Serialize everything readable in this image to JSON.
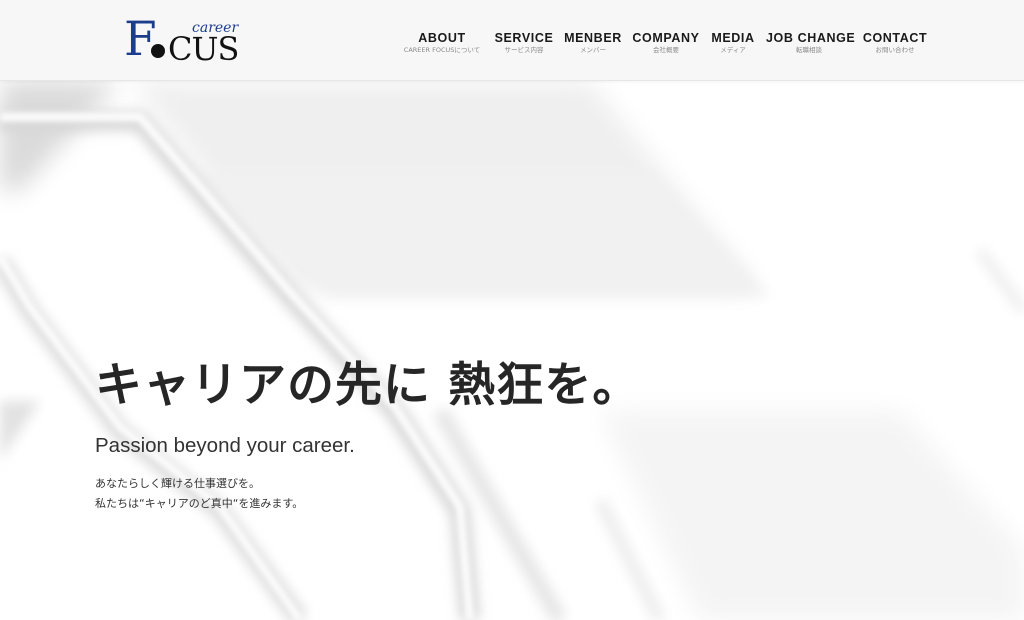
{
  "header": {
    "logo": {
      "big_letter": "F",
      "rest_letters": "CUS",
      "tag": "career",
      "colors": {
        "blue": "#1c3d8c",
        "black": "#111111"
      }
    },
    "nav": [
      {
        "label": "ABOUT",
        "sub": "CAREER FOCUSについて"
      },
      {
        "label": "SERVICE",
        "sub": "サービス内容"
      },
      {
        "label": "MENBER",
        "sub": "メンバー"
      },
      {
        "label": "COMPANY",
        "sub": "会社概要"
      },
      {
        "label": "MEDIA",
        "sub": "メディア"
      },
      {
        "label": "JOB CHANGE",
        "sub": "転職相談"
      },
      {
        "label": "CONTACT",
        "sub": "お問い合わせ"
      }
    ]
  },
  "hero": {
    "headline": "キャリアの先に 熱狂を。",
    "subheadline": "Passion beyond your career.",
    "body_lines": [
      "あなたらしく輝ける仕事選びを。",
      "私たちは“キャリアのど真中“を進みます。"
    ]
  }
}
